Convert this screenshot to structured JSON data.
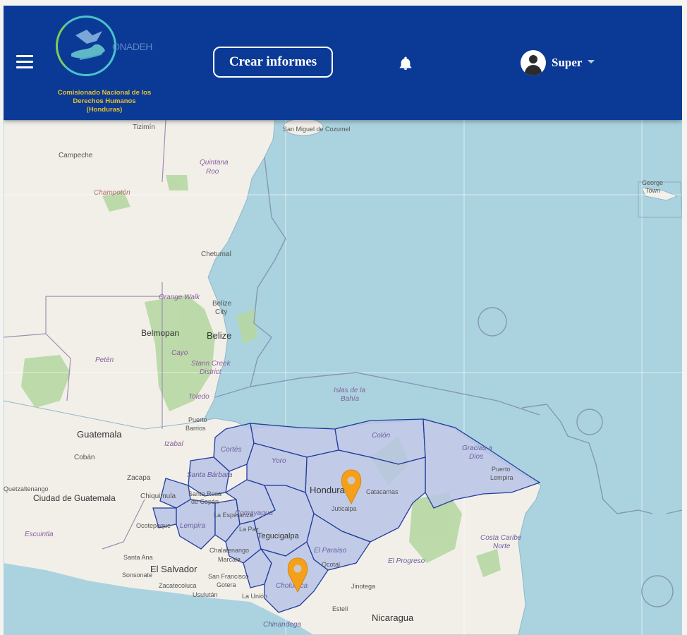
{
  "header": {
    "logo_word": "ONADEH",
    "logo_caption_line1": "Comisionado Nacional de los",
    "logo_caption_line2": "Derechos Humanos",
    "logo_caption_line3": "(Honduras)",
    "create_reports_label": "Crear informes",
    "user_name": "Super",
    "colors": {
      "bar": "#0b3a96",
      "text": "#ffffff",
      "logo_caption": "#e7c12b"
    }
  },
  "map": {
    "colors": {
      "water": "#aad3df",
      "land": "#f2efe9",
      "forest": "#b7d7a3",
      "region_fill": "#b8c4e6",
      "region_stroke": "#233c9c",
      "marker": "#f5a01a"
    },
    "labels": {
      "tizimin": "Tizimín",
      "campeche": "Campeche",
      "champoton": "Champotón",
      "quintana_roo_1": "Quintana",
      "quintana_roo_2": "Roo",
      "cozumel": "San Miguel de Cozumel",
      "chetumal": "Chetumal",
      "orange_walk": "Orange Walk",
      "belize_city_1": "Belize",
      "belize_city_2": "City",
      "belmopan": "Belmopan",
      "belize": "Belize",
      "cayo": "Cayo",
      "stann_creek_1": "Stann Creek",
      "stann_creek_2": "District",
      "toledo": "Toledo",
      "peten": "Petén",
      "islas_1": "Islas de la",
      "islas_2": "Bahía",
      "george_town_1": "George",
      "george_town_2": "Town",
      "puerto_barrios_1": "Puerto",
      "puerto_barrios_2": "Barrios",
      "izabal": "Izabal",
      "guatemala": "Guatemala",
      "coban": "Cobán",
      "zacapa": "Zacapa",
      "chiquimula": "Chiquimula",
      "ciudad_guatemala": "Ciudad de Guatemala",
      "escuintla": "Escuintla",
      "quetzaltenango": "Quetzaltenango",
      "cortes": "Cortés",
      "santa_barbara": "Santa Bárbara",
      "santa_rosa_1": "Santa Rosa",
      "santa_rosa_2": "de Copán",
      "yoro": "Yoro",
      "colon": "Colón",
      "gracias_1": "Gracias a",
      "gracias_2": "Dios",
      "puerto_lempira_1": "Puerto",
      "puerto_lempira_2": "Lempira",
      "honduras": "Honduras",
      "catacamas": "Catacamas",
      "juticalpa": "Juticalpa",
      "comayagua": "Comayagua",
      "la_paz": "La Paz",
      "tegucigalpa": "Tegucigalpa",
      "el_paraiso": "El Paraíso",
      "la_esperanza": "La Esperanza",
      "lempira": "Lempira",
      "ocotepeque": "Ocotepeque",
      "santa_ana": "Santa Ana",
      "el_salvador": "El Salvador",
      "sonsonate": "Sonsonate",
      "zacatecoluca": "Zacatecoluca",
      "san_francisco_1": "San Francisco",
      "san_francisco_2": "Gotera",
      "usulutan": "Usulután",
      "la_union": "La Unión",
      "chalatenango_1": "Chalatenango",
      "marcala": "Marcala",
      "choluteca": "Choluteca",
      "ocotal": "Ocotal",
      "jinotega": "Jinotega",
      "esteli": "Estelí",
      "nicaragua": "Nicaragua",
      "costa_caribe_1": "Costa Caribe",
      "costa_caribe_2": "Norte",
      "chinandega": "Chinandega",
      "el_progreso": "El Progreso"
    }
  }
}
